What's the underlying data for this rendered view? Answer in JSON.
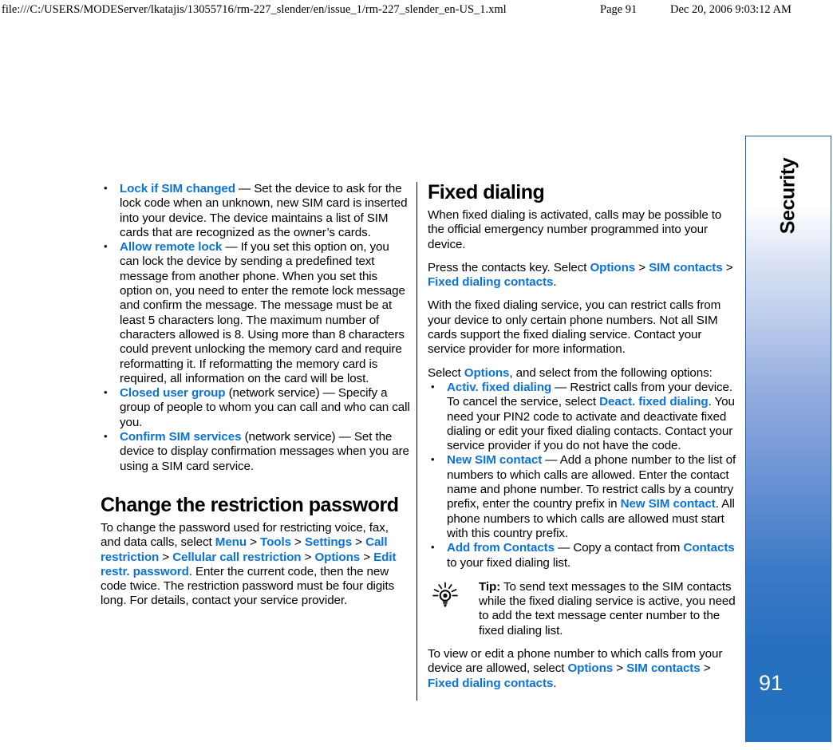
{
  "print_header": {
    "file_path": "file:///C:/USERS/MODEServer/lkatajis/13055716/rm-227_slender/en/issue_1/rm-227_slender_en-US_1.xml",
    "page_label": "Page 91",
    "timestamp": "Dec 20, 2006 9:03:12 AM"
  },
  "side_tab": {
    "chapter_label": "Security",
    "page_number": "91",
    "accent_color": "#2770bf",
    "border_color": "#1e5faa"
  },
  "theme": {
    "link_color": "#0d72d6",
    "text_color": "#000000"
  },
  "left_column": {
    "bullets": [
      {
        "term": "Lock if SIM changed",
        "dash": " — ",
        "body": "Set the device to ask for the lock code when an unknown, new SIM card is inserted into your device. The device maintains a list of SIM cards that are recognized as the owner’s cards."
      },
      {
        "term": "Allow remote lock",
        "dash": " — ",
        "body": "If you set this option on, you can lock the device by sending a predefined text message from another phone. When you set this option on, you need to enter the remote lock message and confirm the message. The message must be at least 5 characters long. The maximum number of characters allowed is 8. Using more than 8 characters could prevent unlocking the memory card and require reformatting it. If reformatting the memory card is required, all information on the card will be lost."
      },
      {
        "term": "Closed user group",
        "paren": " (network service)",
        "dash": " — ",
        "body": "Specify a group of people to whom you can call and who can call you."
      },
      {
        "term": "Confirm SIM services",
        "paren": " (network service)",
        "dash": " — ",
        "body": "Set the device to display confirmation messages when you are using a SIM card service."
      }
    ],
    "heading": "Change the restriction password",
    "para_intro": "To change the password used for restricting voice, fax, and data calls, select ",
    "path": [
      "Menu",
      "Tools",
      "Settings",
      "Call restriction",
      "Cellular call restriction",
      "Options",
      "Edit restr. password"
    ],
    "path_separator": " > ",
    "para_outro": ". Enter the current code, then the new code twice. The restriction password must be four digits long. For details, contact your service provider."
  },
  "right_column": {
    "heading": "Fixed dialing",
    "para_1": "When fixed dialing is activated, calls may be possible to the official emergency number programmed into your device.",
    "para_2_pre": "Press the contacts key. Select ",
    "para_2_path": [
      "Options",
      "SIM contacts",
      "Fixed dialing contacts"
    ],
    "para_2_post": ".",
    "para_3": "With the fixed dialing service, you can restrict calls from your device to only certain phone numbers. Not all SIM cards support the fixed dialing service. Contact your service provider for more information.",
    "para_4_pre": "Select ",
    "para_4_link": "Options",
    "para_4_post": ", and select from the following options:",
    "bullets": [
      {
        "term": "Activ. fixed dialing",
        "dash": " — ",
        "body_1": "Restrict calls from your device. To cancel the service, select ",
        "link_1": "Deact. fixed dialing",
        "body_2": ". You need your PIN2 code to activate and deactivate fixed dialing or edit your fixed dialing contacts. Contact your service provider if you do not have the code."
      },
      {
        "term": "New SIM contact",
        "dash": " — ",
        "body_1": "Add a phone number to the list of numbers to which calls are allowed. Enter the contact name and phone number. To restrict calls by a country prefix, enter the country prefix in ",
        "link_1": "New SIM contact",
        "body_2": ". All phone numbers to which calls are allowed must start with this country prefix."
      },
      {
        "term": "Add from Contacts",
        "dash": " — ",
        "body_1": "Copy a contact from ",
        "link_1": "Contacts",
        "body_2": " to your fixed dialing list."
      }
    ],
    "tip": {
      "icon": "lightbulb-icon",
      "label": "Tip:",
      "text": " To send text messages to the SIM contacts while the fixed dialing service is active, you need to add the text message center number to the fixed dialing list."
    },
    "para_5_pre": "To view or edit a phone number to which calls from your device are allowed, select ",
    "para_5_path": [
      "Options",
      "SIM contacts",
      "Fixed dialing contacts"
    ],
    "para_5_post": "."
  }
}
